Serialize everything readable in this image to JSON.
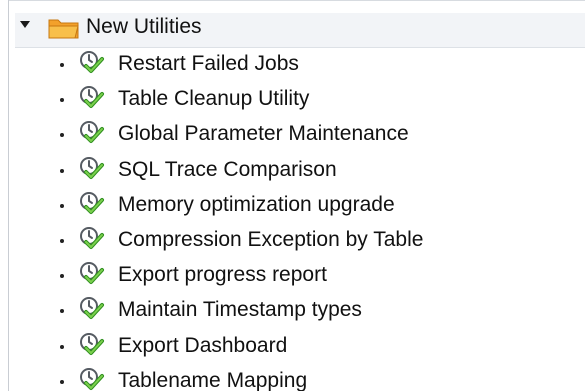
{
  "tree": {
    "folder": {
      "label": "New Utilities",
      "icon": "folder-open-icon",
      "expanded": true
    },
    "items": [
      {
        "label": "Restart Failed Jobs",
        "icon": "transaction-check-icon"
      },
      {
        "label": "Table Cleanup Utility",
        "icon": "transaction-check-icon"
      },
      {
        "label": "Global Parameter Maintenance",
        "icon": "transaction-check-icon"
      },
      {
        "label": "SQL Trace Comparison",
        "icon": "transaction-check-icon"
      },
      {
        "label": "Memory optimization upgrade",
        "icon": "transaction-check-icon"
      },
      {
        "label": "Compression Exception by Table",
        "icon": "transaction-check-icon"
      },
      {
        "label": "Export progress report",
        "icon": "transaction-check-icon"
      },
      {
        "label": "Maintain Timestamp types",
        "icon": "transaction-check-icon"
      },
      {
        "label": "Export Dashboard",
        "icon": "transaction-check-icon"
      },
      {
        "label": "Tablename Mapping",
        "icon": "transaction-check-icon"
      }
    ]
  },
  "colors": {
    "folder_fill": "#f3a12b",
    "folder_dark": "#d9801a",
    "check_green": "#4caf2a",
    "clock_gray": "#5a5f66"
  }
}
